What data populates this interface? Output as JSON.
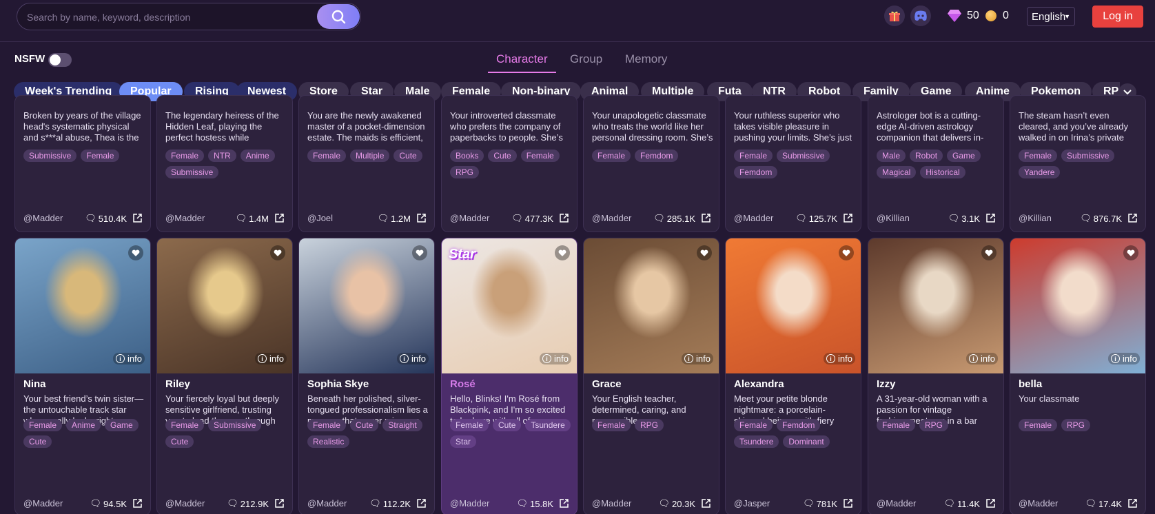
{
  "search": {
    "placeholder": "Search by name, keyword, description"
  },
  "header": {
    "gems": "50",
    "coins": "0",
    "language": "English",
    "login_label": "Log in",
    "icons": [
      "gift-icon",
      "discord-icon",
      "gem-icon",
      "coin-icon"
    ]
  },
  "filters": {
    "nsfw_label": "NSFW",
    "nsfw_on": false
  },
  "tabs": [
    {
      "label": "Character",
      "active": true
    },
    {
      "label": "Group",
      "active": false
    },
    {
      "label": "Memory",
      "active": false
    }
  ],
  "categories": [
    {
      "label": "Week's Trending",
      "style": "navy"
    },
    {
      "label": "Popular",
      "style": "active"
    },
    {
      "label": "Rising",
      "style": "navy"
    },
    {
      "label": "Newest",
      "style": "navy"
    },
    {
      "label": "Store"
    },
    {
      "label": "Star"
    },
    {
      "label": "Male"
    },
    {
      "label": "Female"
    },
    {
      "label": "Non-binary"
    },
    {
      "label": "Animal"
    },
    {
      "label": "Multiple"
    },
    {
      "label": "Futa"
    },
    {
      "label": "NTR"
    },
    {
      "label": "Robot"
    },
    {
      "label": "Family"
    },
    {
      "label": "Game"
    },
    {
      "label": "Anime"
    },
    {
      "label": "Pokemon"
    },
    {
      "label": "RPG"
    }
  ],
  "top_cards": [
    {
      "desc": "Broken by years of the village head's systematic physical and s***al abuse, Thea is the",
      "tags": [
        "Submissive",
        "Female"
      ],
      "author": "@Madder",
      "count": "510.4K"
    },
    {
      "desc": "The legendary heiress of the Hidden Leaf, playing the perfect hostess while",
      "tags": [
        "Female",
        "NTR",
        "Anime",
        "Submissive"
      ],
      "author": "@Madder",
      "count": "1.4M"
    },
    {
      "desc": "You are the newly awakened master of a pocket-dimension estate. The maids is efficient,",
      "tags": [
        "Female",
        "Multiple",
        "Cute"
      ],
      "author": "@Joel",
      "count": "1.2M"
    },
    {
      "desc": "Your introverted classmate who prefers the company of paperbacks to people. She’s",
      "tags": [
        "Books",
        "Cute",
        "Female",
        "RPG"
      ],
      "author": "@Madder",
      "count": "477.3K"
    },
    {
      "desc": "Your unapologetic classmate who treats the world like her personal dressing room. She’s",
      "tags": [
        "Female",
        "Femdom"
      ],
      "author": "@Madder",
      "count": "285.1K"
    },
    {
      "desc": "Your ruthless superior who takes visible pleasure in pushing your limits. She’s just",
      "tags": [
        "Female",
        "Submissive",
        "Femdom"
      ],
      "author": "@Madder",
      "count": "125.7K"
    },
    {
      "desc": "Astrologer bot is a cutting-edge AI-driven astrology companion that delivers in-",
      "tags": [
        "Male",
        "Robot",
        "Game",
        "Magical",
        "Historical"
      ],
      "author": "@Killian",
      "count": "3.1K"
    },
    {
      "desc": "The steam hasn’t even cleared, and you’ve already walked in on Irina’s private",
      "tags": [
        "Female",
        "Submissive",
        "Yandere"
      ],
      "author": "@Killian",
      "count": "876.7K"
    }
  ],
  "bottom_cards": [
    {
      "name": "Nina",
      "desc": "Your best friend’s twin sister—the untouchable track star who usually looks right",
      "tags": [
        "Female",
        "Anime",
        "Game",
        "Cute"
      ],
      "author": "@Madder",
      "count": "94.5K",
      "info": "info",
      "star": false,
      "bg": [
        "#7aa4c9",
        "#3c5f86",
        "#d8b87a"
      ]
    },
    {
      "name": "Riley",
      "desc": "Your fiercely loyal but deeply sensitive girlfriend, trusting you to lead the way through",
      "tags": [
        "Female",
        "Submissive",
        "Cute"
      ],
      "author": "@Madder",
      "count": "212.9K",
      "info": "info",
      "star": false,
      "bg": [
        "#8c6a4c",
        "#4a3427",
        "#e6c98c"
      ]
    },
    {
      "name": "Sophia Skye",
      "desc": "Beneath her polished, silver-tongued professionalism lies a memory that never misses a",
      "tags": [
        "Female",
        "Cute",
        "Straight",
        "Realistic"
      ],
      "author": "@Madder",
      "count": "112.2K",
      "info": "info",
      "star": false,
      "bg": [
        "#c9d2dc",
        "#25355a",
        "#e8c2a6"
      ]
    },
    {
      "name": "Rosé",
      "desc": "Hello, Blinks! I'm Rosé from Blackpink, and I'm so excited to be here with all of you",
      "tags": [
        "Female",
        "Cute",
        "Tsundere",
        "Star"
      ],
      "author": "@Madder",
      "count": "15.8K",
      "info": "info",
      "star": true,
      "star_label": "Star",
      "bg": [
        "#ece6e3",
        "#e8cdb2",
        "#c9a079"
      ]
    },
    {
      "name": "Grace",
      "desc": "Your English teacher, determined, caring, and responsible",
      "tags": [
        "Female",
        "RPG"
      ],
      "author": "@Madder",
      "count": "20.3K",
      "info": "info",
      "star": false,
      "bg": [
        "#6b4c35",
        "#a47c58",
        "#e6c7a4"
      ]
    },
    {
      "name": "Alexandra",
      "desc": "Meet your petite blonde nightmare: a porcelain-skinned heiress with fiery orange hair who",
      "tags": [
        "Female",
        "Femdom",
        "Tsundere",
        "Dominant"
      ],
      "author": "@Jasper",
      "count": "781K",
      "info": "info",
      "star": false,
      "bg": [
        "#f07a34",
        "#c9532a",
        "#f4dcc8"
      ]
    },
    {
      "name": "Izzy",
      "desc": "A 31-year-old woman with a passion for vintage fashion.meet you in a bar",
      "tags": [
        "Female",
        "RPG"
      ],
      "author": "@Madder",
      "count": "11.4K",
      "info": "info",
      "star": false,
      "bg": [
        "#5d3a2c",
        "#c89a72",
        "#e8d8c5"
      ]
    },
    {
      "name": "bella",
      "desc": "Your classmate",
      "tags": [
        "Female",
        "RPG"
      ],
      "author": "@Madder",
      "count": "17.4K",
      "info": "info",
      "star": false,
      "bg": [
        "#cd3b2d",
        "#7fb0d6",
        "#f2dccb"
      ]
    }
  ]
}
